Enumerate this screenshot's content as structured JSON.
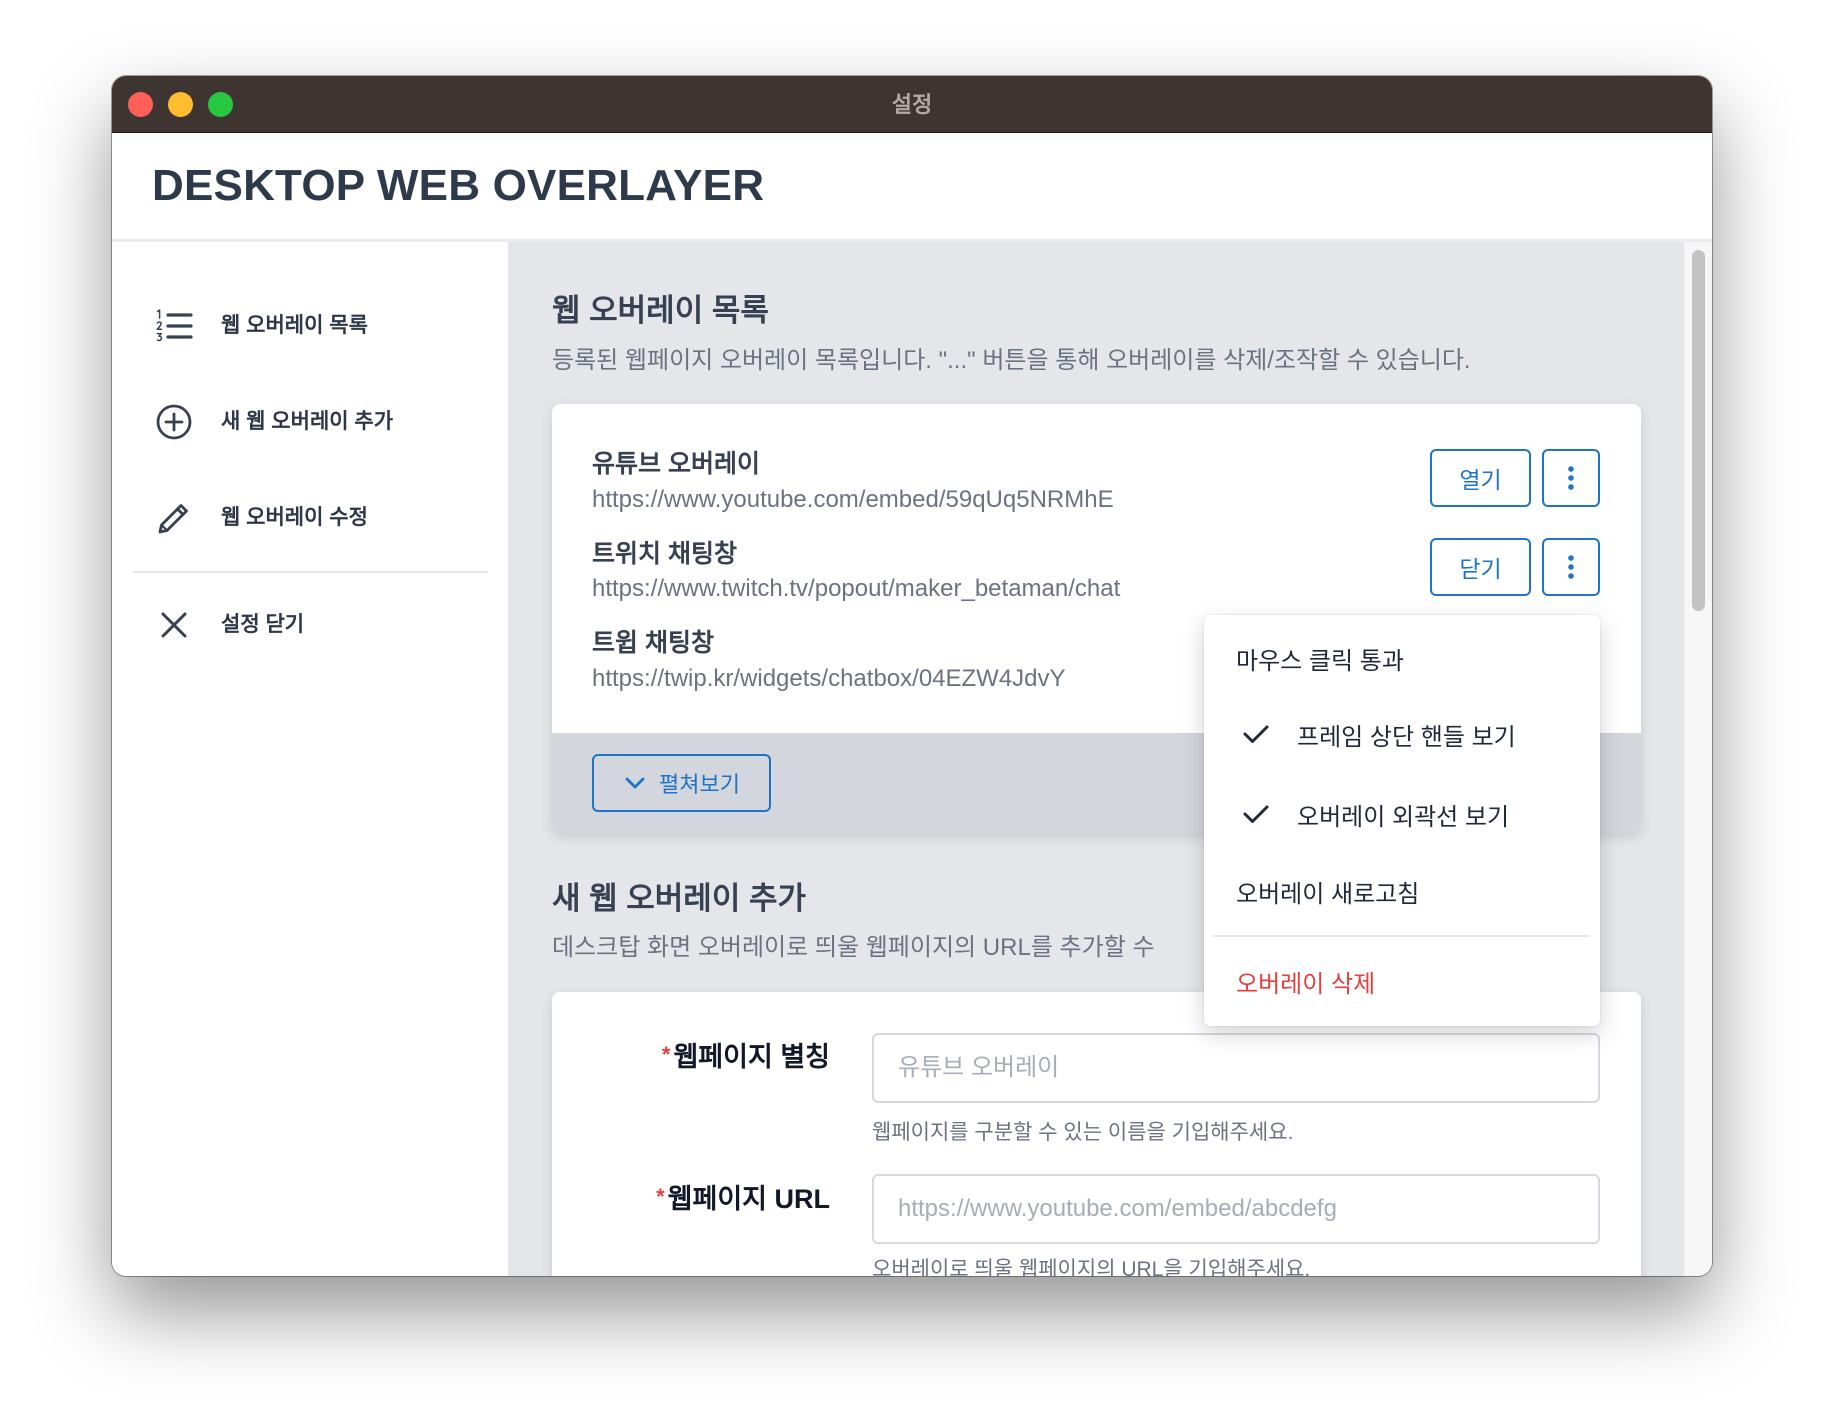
{
  "window": {
    "title": "설정"
  },
  "app": {
    "title": "DESKTOP WEB OVERLAYER"
  },
  "sidebar": {
    "items": [
      {
        "label": "웹 오버레이 목록",
        "icon": "numbered-list-icon"
      },
      {
        "label": "새 웹 오버레이 추가",
        "icon": "plus-circle-icon"
      },
      {
        "label": "웹 오버레이 수정",
        "icon": "pencil-icon"
      }
    ],
    "close": {
      "label": "설정 닫기",
      "icon": "close-icon"
    }
  },
  "list_section": {
    "title": "웹 오버레이 목록",
    "description": "등록된 웹페이지 오버레이 목록입니다. \"...\" 버튼을 통해 오버레이를 삭제/조작할 수 있습니다.",
    "overlays": [
      {
        "name": "유튜브 오버레이",
        "url": "https://www.youtube.com/embed/59qUq5NRMhE",
        "action_label": "열기"
      },
      {
        "name": "트위치 채팅창",
        "url": "https://www.twitch.tv/popout/maker_betaman/chat",
        "action_label": "닫기"
      },
      {
        "name": "트윕 채팅창",
        "url": "https://twip.kr/widgets/chatbox/04EZW4JdvY"
      }
    ],
    "more_icon": "kebab-menu-icon",
    "expand_label": "펼쳐보기",
    "expand_icon": "chevron-down-icon"
  },
  "context_menu": {
    "items": [
      {
        "label": "마우스 클릭 통과",
        "checked": false
      },
      {
        "label": "프레임 상단 핸들 보기",
        "checked": true
      },
      {
        "label": "오버레이 외곽선 보기",
        "checked": true
      },
      {
        "label": "오버레이 새로고침",
        "checked": false
      }
    ],
    "delete_label": "오버레이 삭제"
  },
  "add_section": {
    "title": "새 웹 오버레이 추가",
    "description": "데스크탑 화면 오버레이로 띄울 웹페이지의 URL를 추가할 수",
    "form": {
      "name_field": {
        "required_mark": "*",
        "label": "웹페이지 별칭",
        "value": "",
        "placeholder": "유튜브 오버레이",
        "help": "웹페이지를 구분할 수 있는 이름을 기입해주세요."
      },
      "url_field": {
        "required_mark": "*",
        "label": "웹페이지 URL",
        "value": "",
        "placeholder": "https://www.youtube.com/embed/abcdefg",
        "help": "오버레이로 띄울 웹페이지의 URL을 기입해주세요."
      }
    }
  },
  "colors": {
    "accent": "#1f74c8",
    "danger": "#e53e3e",
    "titlebar": "#3e3532",
    "main_background": "#e4e6ea"
  }
}
